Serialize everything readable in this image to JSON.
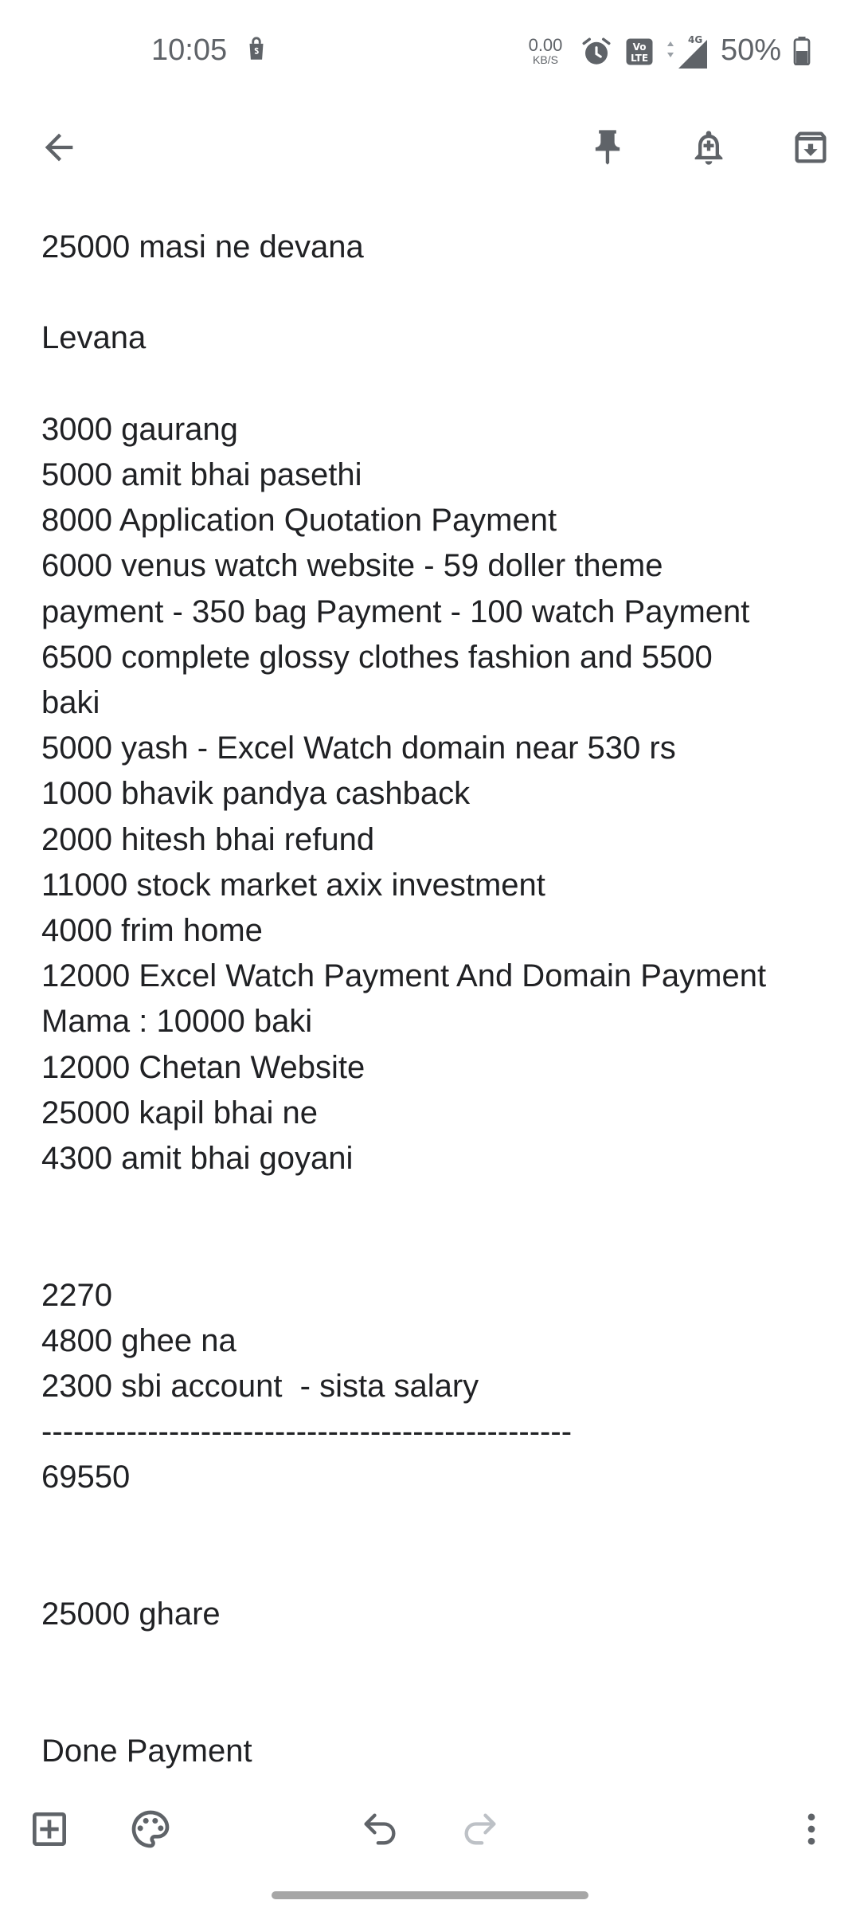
{
  "status_bar": {
    "time": "10:05",
    "network_speed_value": "0.00",
    "network_speed_unit": "KB/S",
    "network_type": "4G",
    "battery_percent": "50%",
    "icons": [
      "shopping-bag-icon",
      "alarm-icon",
      "volte-icon",
      "signal-icon",
      "battery-icon"
    ]
  },
  "toolbar": {
    "back": "arrow-back-icon",
    "pin": "pin-icon",
    "reminder": "bell-plus-icon",
    "archive": "archive-icon"
  },
  "note": {
    "lines": [
      "25000 masi ne devana",
      "",
      "Levana",
      "",
      "3000 gaurang",
      "5000 amit bhai pasethi",
      "8000 Application Quotation Payment",
      "6000 venus watch website - 59 doller theme",
      "payment - 350 bag Payment - 100 watch Payment",
      "6500 complete glossy clothes fashion and 5500",
      "baki",
      "5000 yash - Excel Watch domain near 530 rs",
      "1000 bhavik pandya cashback",
      "2000 hitesh bhai refund",
      "11000 stock market axix investment",
      "4000 frim home",
      "12000 Excel Watch Payment And Domain Payment",
      "Mama : 10000 baki",
      "12000 Chetan Website",
      "25000 kapil bhai ne",
      "4300 amit bhai goyani",
      "",
      "",
      "2270",
      "4800 ghee na",
      "2300 sbi account  - sista salary",
      "--------------------------------------------------",
      "69550",
      "",
      "",
      "25000 ghare",
      "",
      "",
      "Done Payment"
    ]
  },
  "bottom_bar": {
    "add": "add-box-icon",
    "palette": "palette-icon",
    "undo": "undo-icon",
    "redo": "redo-icon",
    "redo_enabled": false,
    "more": "more-vert-icon"
  },
  "colors": {
    "icon": "#5f6368",
    "icon_disabled": "#bdc1c6",
    "text": "#202124",
    "background": "#ffffff"
  }
}
